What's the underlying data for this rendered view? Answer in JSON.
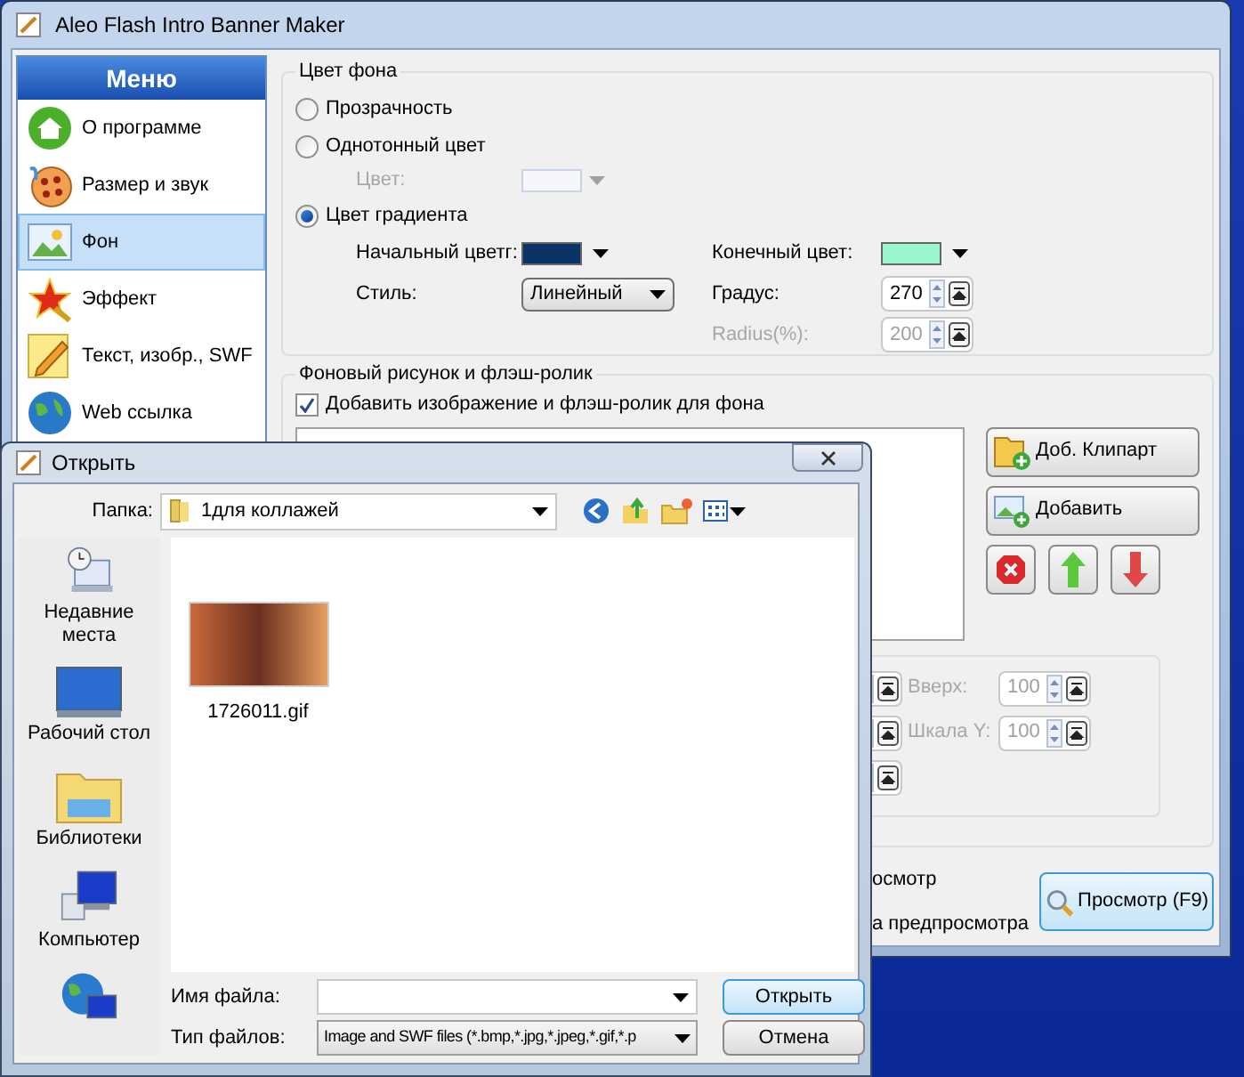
{
  "window": {
    "title": "Aleo Flash Intro Banner Maker"
  },
  "menu": {
    "title": "Меню",
    "items": [
      {
        "label": "О программе",
        "selected": false
      },
      {
        "label": "Размер и звук",
        "selected": false
      },
      {
        "label": "Фон",
        "selected": true
      },
      {
        "label": "Эффект",
        "selected": false
      },
      {
        "label": "Текст, изобр., SWF",
        "selected": false
      },
      {
        "label": "Web ссылка",
        "selected": false
      }
    ]
  },
  "background_color": {
    "title": "Цвет фона",
    "options": [
      {
        "label": "Прозрачность",
        "selected": false
      },
      {
        "label": "Однотонный цвет",
        "selected": false
      },
      {
        "label": "Цвет градиента",
        "selected": true
      }
    ],
    "solid_color": {
      "label": "Цвет:",
      "disabled": true
    },
    "start_color": {
      "label": "Начальный цветг:",
      "color": "#0a3366"
    },
    "end_color": {
      "label": "Конечный цвет:",
      "color": "#99f7cc"
    },
    "style": {
      "label": "Стиль:",
      "value": "Линейный"
    },
    "degree": {
      "label": "Градус:",
      "value": "270",
      "disabled": false
    },
    "radius": {
      "label": "Radius(%):",
      "value": "200",
      "disabled": true
    }
  },
  "background_media": {
    "title": "Фоновый рисунок и флэш-ролик",
    "add_checkbox": {
      "label": "Добавить изображение и флэш-ролик для фона",
      "checked": true
    },
    "buttons": [
      "Доб. Клипарт",
      "Добавить"
    ],
    "position_fields": [
      {
        "label": "Вверх:",
        "value": "100",
        "disabled": true
      },
      {
        "label": "Шкала Y:",
        "value": "100",
        "disabled": true
      }
    ]
  },
  "bottom": {
    "partial_texts": [
      "осмотр",
      "а предпросмотра"
    ],
    "preview_button": "Просмотр (F9)"
  },
  "dialog": {
    "title": "Открыть",
    "folder_label": "Папка:",
    "folder": "1для коллажей",
    "places": [
      {
        "label": "Недавние места"
      },
      {
        "label": "Рабочий стол"
      },
      {
        "label": "Библиотеки"
      },
      {
        "label": "Компьютер"
      }
    ],
    "files": [
      {
        "name": "1726011.gif"
      }
    ],
    "file_name_label": "Имя файла:",
    "file_type_label": "Тип файлов:",
    "file_type": "Image and SWF files (*.bmp,*.jpg,*.jpeg,*.gif,*.p",
    "buttons": [
      "Открыть",
      "Отмена"
    ]
  }
}
